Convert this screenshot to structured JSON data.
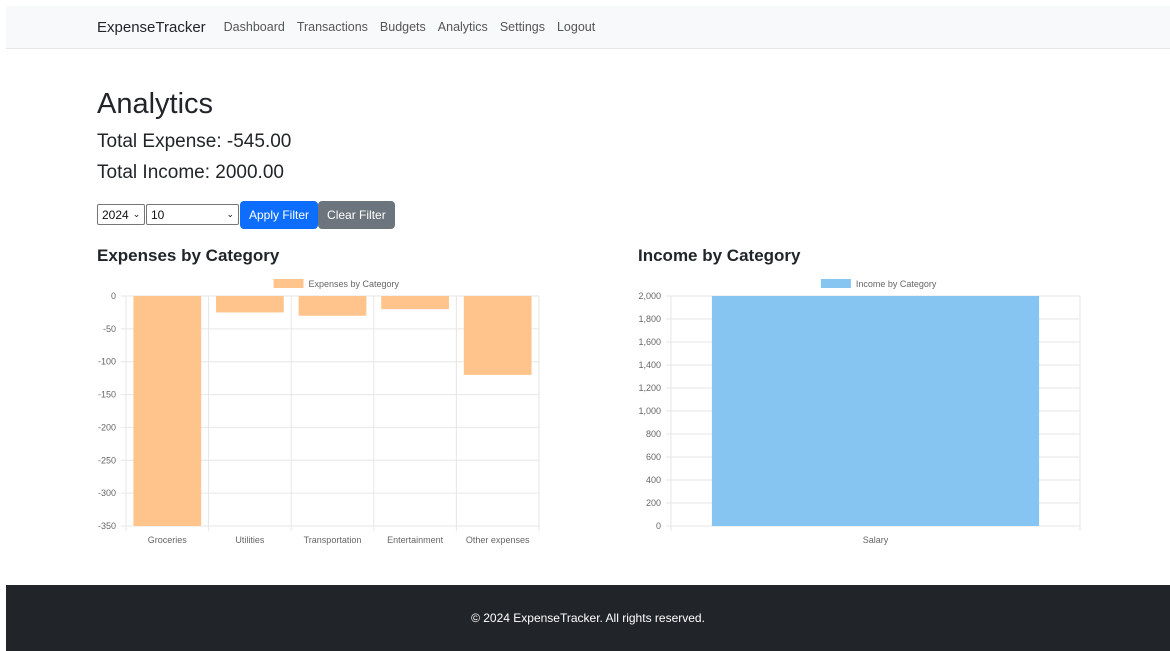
{
  "navbar": {
    "brand": "ExpenseTracker",
    "links": [
      "Dashboard",
      "Transactions",
      "Budgets",
      "Analytics",
      "Settings",
      "Logout"
    ]
  },
  "page": {
    "title": "Analytics",
    "total_expense": "Total Expense: -545.00",
    "total_income": "Total Income: 2000.00"
  },
  "filters": {
    "year": "2024",
    "month": "10",
    "apply_label": "Apply Filter",
    "clear_label": "Clear Filter"
  },
  "expenses_heading": "Expenses by Category",
  "income_heading": "Income by Category",
  "chart_data": [
    {
      "type": "bar",
      "title": "",
      "categories": [
        "Groceries",
        "Utilities",
        "Transportation",
        "Entertainment",
        "Other expenses"
      ],
      "series": [
        {
          "name": "Expenses by Category",
          "values": [
            -350,
            -25,
            -30,
            -20,
            -120
          ]
        }
      ],
      "ylim": [
        -350,
        0
      ],
      "yticks": [
        0,
        -50,
        -100,
        -150,
        -200,
        -250,
        -300,
        -350
      ],
      "ytick_labels": [
        "0",
        "-50",
        "-100",
        "-150",
        "-200",
        "-250",
        "-300",
        "-350"
      ],
      "xlabel": "",
      "ylabel": "",
      "grid": true,
      "legend": "top-center",
      "color": "#ffc48c"
    },
    {
      "type": "bar",
      "title": "",
      "categories": [
        "Salary"
      ],
      "series": [
        {
          "name": "Income by Category",
          "values": [
            2000
          ]
        }
      ],
      "ylim": [
        0,
        2000
      ],
      "yticks": [
        0,
        200,
        400,
        600,
        800,
        1000,
        1200,
        1400,
        1600,
        1800,
        2000
      ],
      "ytick_labels": [
        "0",
        "200",
        "400",
        "600",
        "800",
        "1,000",
        "1,200",
        "1,400",
        "1,600",
        "1,800",
        "2,000"
      ],
      "xlabel": "",
      "ylabel": "",
      "grid": true,
      "legend": "top-center",
      "color": "#86c5f2"
    }
  ],
  "footer": {
    "text": "© 2024 ExpenseTracker. All rights reserved."
  }
}
